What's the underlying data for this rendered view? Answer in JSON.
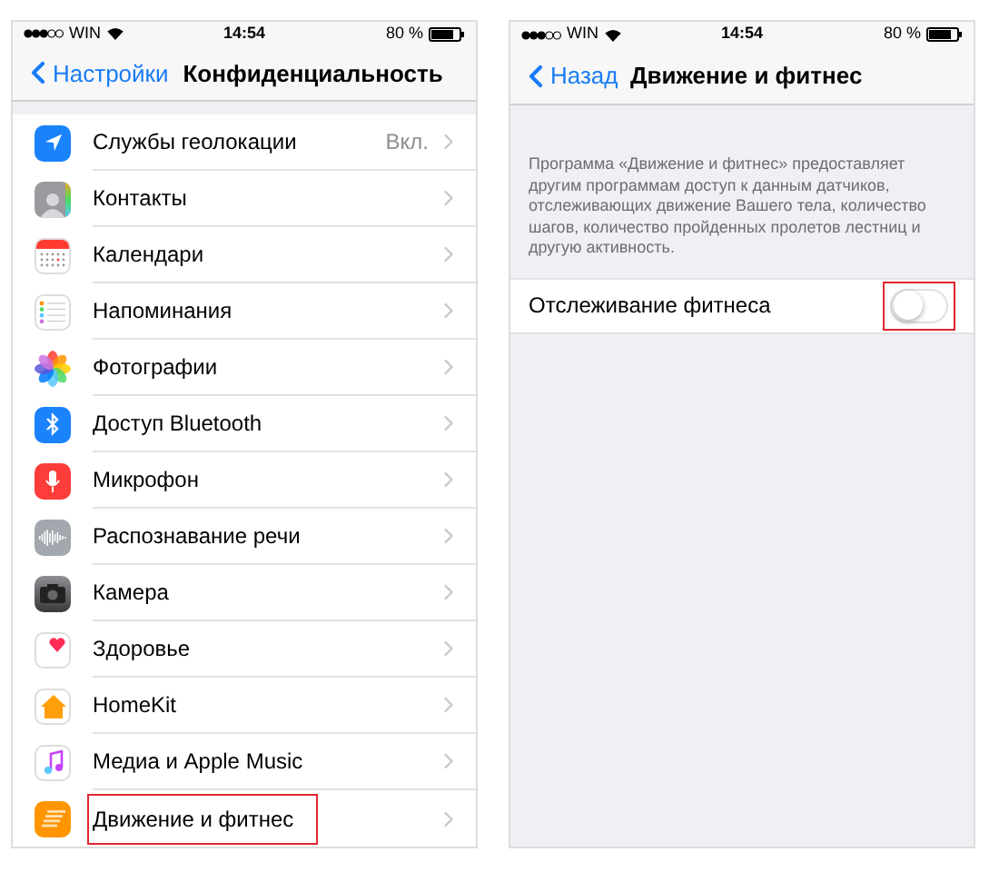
{
  "screens": [
    {
      "status_bar": {
        "carrier": "WIN",
        "time": "14:54",
        "battery": "80 %"
      },
      "nav": {
        "back": "Настройки",
        "title": "Конфиденциальность"
      },
      "items": [
        {
          "label": "Службы геолокации",
          "value": "Вкл.",
          "highlighted": false
        },
        {
          "label": "Контакты",
          "highlighted": false
        },
        {
          "label": "Календари",
          "highlighted": false
        },
        {
          "label": "Напоминания",
          "highlighted": false
        },
        {
          "label": "Фотографии",
          "highlighted": false
        },
        {
          "label": "Доступ Bluetooth",
          "highlighted": false
        },
        {
          "label": "Микрофон",
          "highlighted": false
        },
        {
          "label": "Распознавание речи",
          "highlighted": false
        },
        {
          "label": "Камера",
          "highlighted": false
        },
        {
          "label": "Здоровье",
          "highlighted": false
        },
        {
          "label": "HomeKit",
          "highlighted": false
        },
        {
          "label": "Медиа и Apple Music",
          "highlighted": false
        },
        {
          "label": "Движение и фитнес",
          "highlighted": true
        }
      ]
    },
    {
      "status_bar": {
        "carrier": "WIN",
        "time": "14:54",
        "battery": "80 %"
      },
      "nav": {
        "back": "Назад",
        "title": "Движение и фитнес"
      },
      "description": "Программа «Движение и фитнес» предоставляет другим программам доступ к данным датчиков, отслеживающих движение Вашего тела, количество шагов, количество пройденных пролетов лестниц и другую активность.",
      "toggle": {
        "label": "Отслеживание фитнеса",
        "on": false,
        "highlighted": true
      }
    }
  ]
}
